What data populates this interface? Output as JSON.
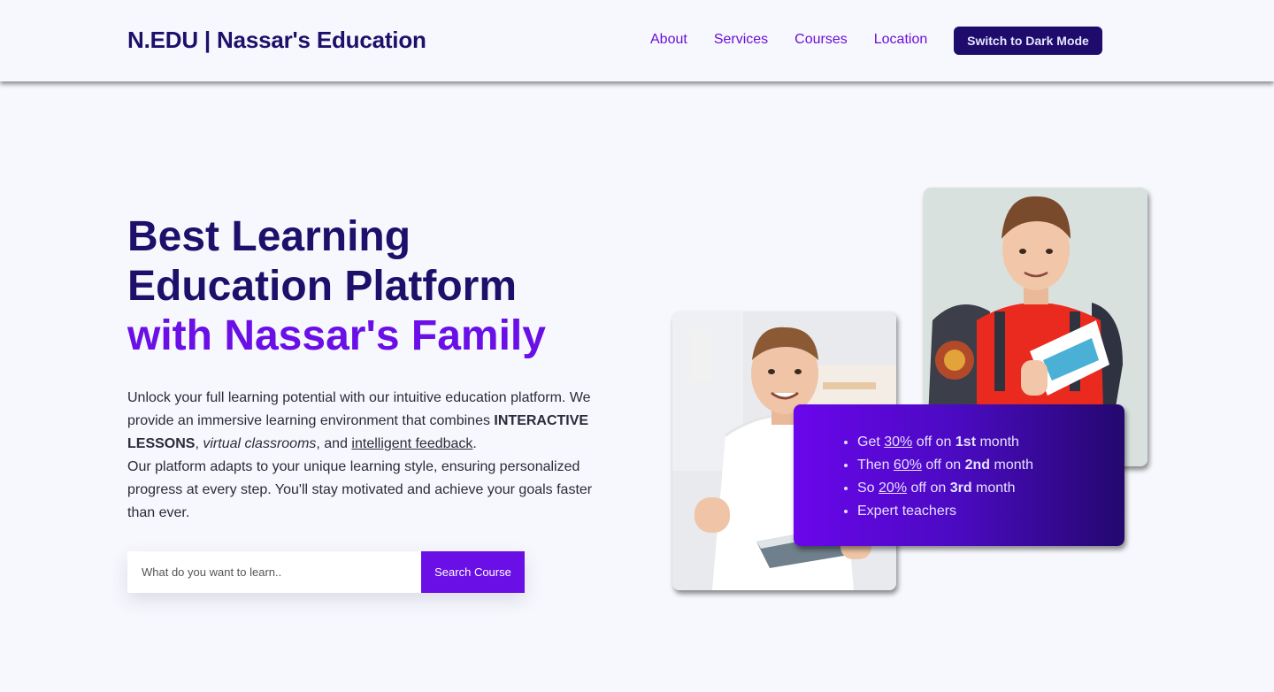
{
  "header": {
    "brand": "N.EDU | Nassar's Education",
    "nav": [
      "About",
      "Services",
      "Courses",
      "Location"
    ],
    "dark_mode_button": "Switch to Dark Mode"
  },
  "hero": {
    "title_line1": "Best Learning",
    "title_line2": "Education Platform",
    "title_line3": "with Nassar's Family",
    "desc": {
      "p1_start": "Unlock your full learning potential with our intuitive education platform. We provide an immersive learning environment that combines ",
      "bold": "INTERACTIVE LESSONS",
      "comma": ", ",
      "italic": "virtual classrooms",
      "and": ", and ",
      "link": "intelligent feedback",
      "period": ".",
      "p2": "Our platform adapts to your unique learning style, ensuring personalized progress at every step. You'll stay motivated and achieve your goals faster than ever."
    },
    "search": {
      "placeholder": "What do you want to learn..",
      "button": "Search Course"
    }
  },
  "offer": {
    "items": [
      {
        "prefix": "Get ",
        "percent": "30%",
        "mid": " off on ",
        "ordinal": "1st",
        "suffix": " month"
      },
      {
        "prefix": "Then ",
        "percent": "60%",
        "mid": " off on ",
        "ordinal": "2nd",
        "suffix": " month"
      },
      {
        "prefix": "So ",
        "percent": "20%",
        "mid": " off on ",
        "ordinal": "3rd",
        "suffix": " month"
      }
    ],
    "last_item": "Expert teachers"
  },
  "colors": {
    "brand_dark": "#1e0f6b",
    "accent_purple": "#6a0fe6",
    "background": "#f7f8fd"
  }
}
